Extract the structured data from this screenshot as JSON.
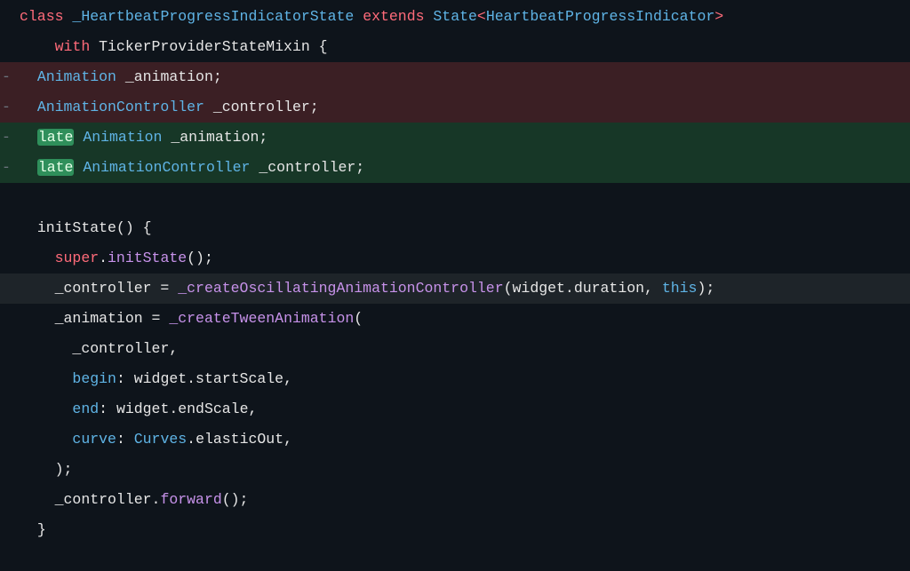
{
  "lines": {
    "l1_class": "class",
    "l1_name": "_HeartbeatProgressIndicatorState",
    "l1_extends": "extends",
    "l1_state": "State",
    "l1_lt": "<",
    "l1_param": "HeartbeatProgressIndicator",
    "l1_gt": ">",
    "l2_with": "with",
    "l2_mixin": "TickerProviderStateMixin {",
    "l3_type": "Animation",
    "l3_var": "_animation;",
    "l4_type": "AnimationController",
    "l4_var": "_controller;",
    "l5_late": "late",
    "l5_type": "Animation",
    "l5_var": "_animation;",
    "l6_late": "late",
    "l6_type": "AnimationController",
    "l6_var": "_controller;",
    "l8_init": "initState() {",
    "l9_super": "super",
    "l9_dot": ".",
    "l9_call": "initState",
    "l9_tail": "();",
    "l10_ctrl": "_controller = ",
    "l10_fn": "_createOscillatingAnimationController",
    "l10_open": "(widget.duration, ",
    "l10_this": "this",
    "l10_close": ");",
    "l11_anim": "_animation = ",
    "l11_fn": "_createTweenAnimation",
    "l11_open": "(",
    "l12_ctrl": "_controller,",
    "l13_k": "begin",
    "l13_v": ": widget.startScale,",
    "l14_k": "end",
    "l14_v": ": widget.endScale,",
    "l15_k": "curve",
    "l15_colon": ": ",
    "l15_cls": "Curves",
    "l15_tail": ".elasticOut,",
    "l16_close": ");",
    "l17_ctrl": "_controller.",
    "l17_fwd": "forward",
    "l17_tail": "();",
    "l18_brace": "}"
  },
  "marks": {
    "minus": "-"
  }
}
